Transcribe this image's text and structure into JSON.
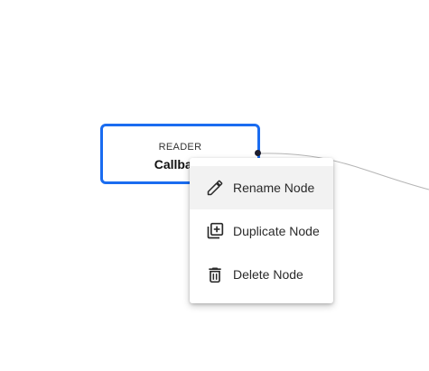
{
  "node": {
    "type_label": "READER",
    "name": "Callback",
    "border_color": "#1a6cf0"
  },
  "context_menu": {
    "items": [
      {
        "label": "Rename Node",
        "icon": "pencil-icon",
        "hovered": true
      },
      {
        "label": "Duplicate Node",
        "icon": "duplicate-icon",
        "hovered": false
      },
      {
        "label": "Delete Node",
        "icon": "trash-icon",
        "hovered": false
      }
    ]
  },
  "colors": {
    "accent": "#1a6cf0",
    "edge": "#b5b5b5",
    "hover_bg": "#f2f2f2"
  }
}
